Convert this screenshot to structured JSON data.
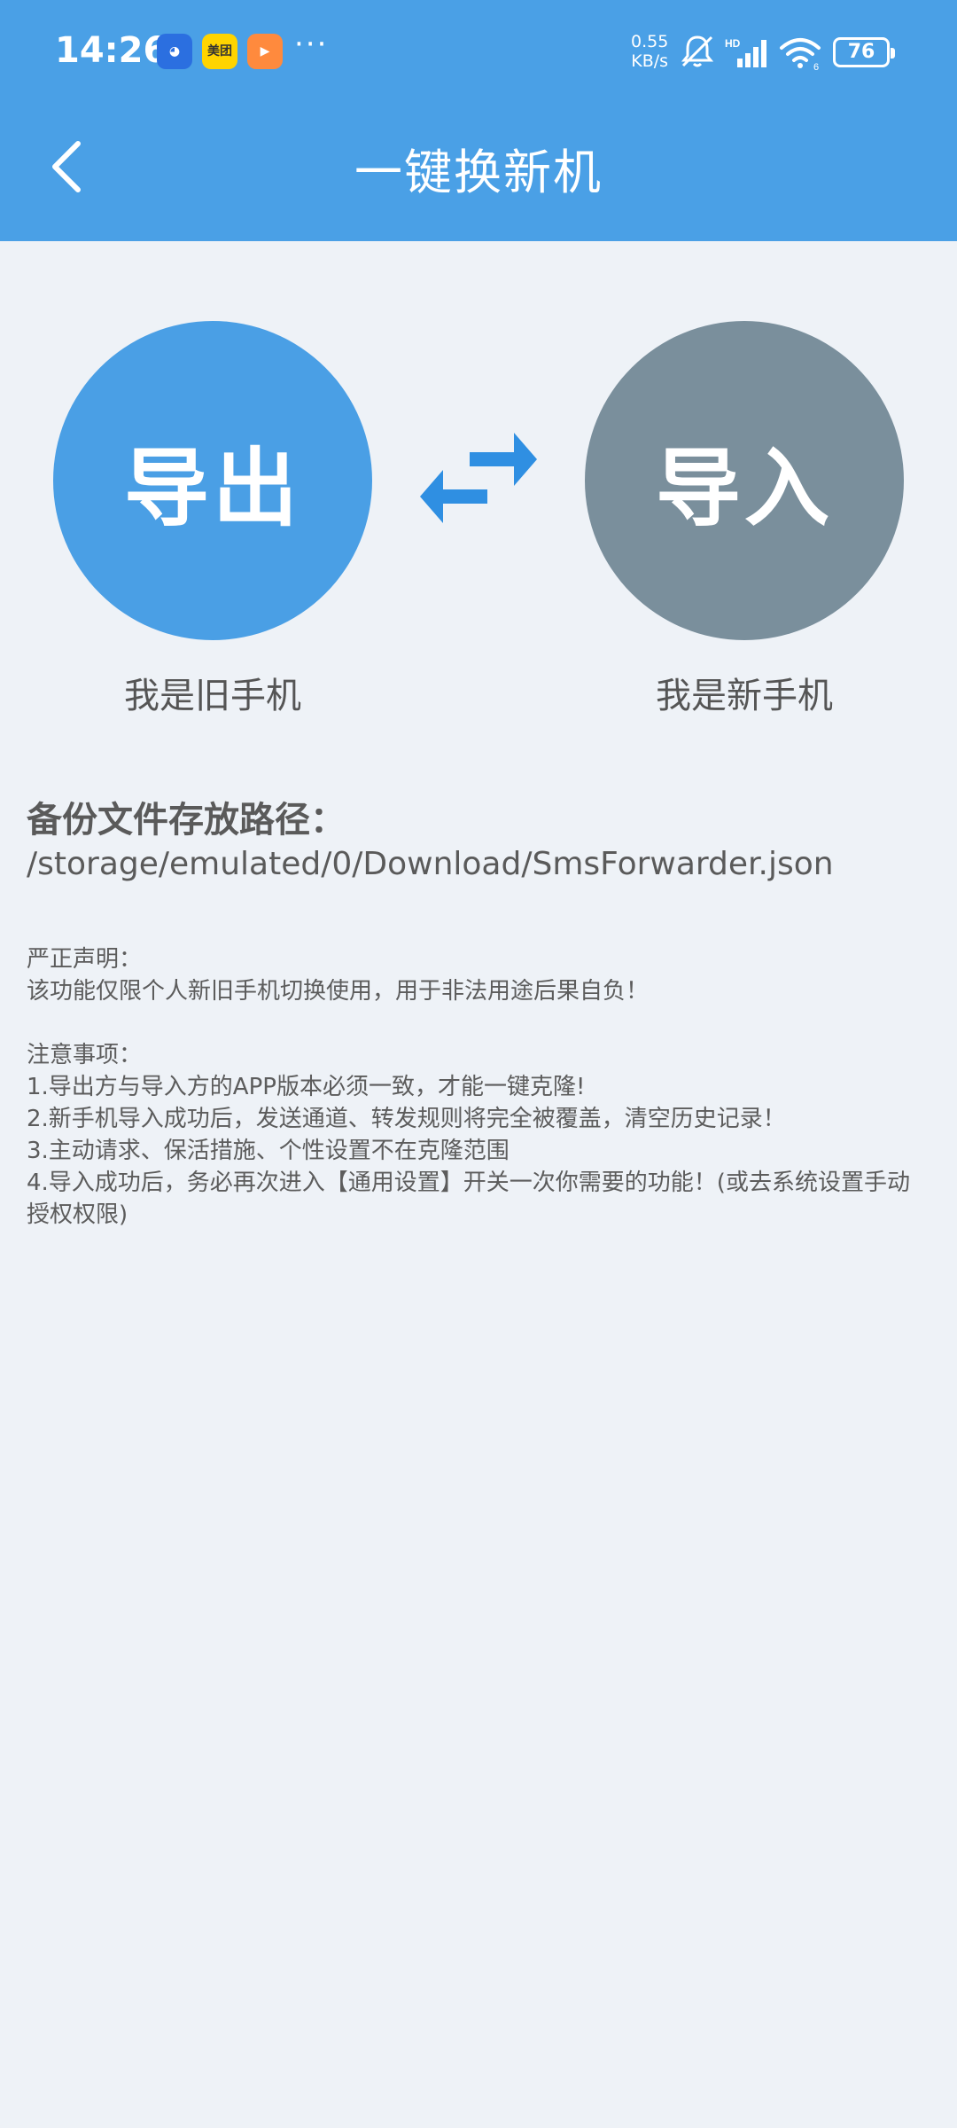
{
  "status_bar": {
    "time": "14:26",
    "app_icons": [
      "qq-icon",
      "meituan-icon",
      "video-icon"
    ],
    "meituan_label": "美团",
    "more": "···",
    "net_speed_value": "0.55",
    "net_speed_unit": "KB/s",
    "signal_label": "HD",
    "wifi_label": "6",
    "battery": "76"
  },
  "header": {
    "title": "一键换新机",
    "back_icon": "back-arrow-icon"
  },
  "actions": {
    "export_label": "导出",
    "import_label": "导入",
    "export_caption": "我是旧手机",
    "import_caption": "我是新手机",
    "swap_icon": "swap-arrows-icon"
  },
  "backup": {
    "label": "备份文件存放路径：",
    "path": "/storage/emulated/0/Download/SmsForwarder.json"
  },
  "notes": {
    "disclaimer_title": "严正声明：",
    "disclaimer_text": "该功能仅限个人新旧手机切换使用，用于非法用途后果自负！",
    "notice_title": "注意事项：",
    "items": [
      "1.导出方与导入方的APP版本必须一致，才能一键克隆!",
      "2.新手机导入成功后，发送通道、转发规则将完全被覆盖，清空历史记录！",
      "3.主动请求、保活措施、个性设置不在克隆范围",
      "4.导入成功后，务必再次进入【通用设置】开关一次你需要的功能！(或去系统设置手动授权权限)"
    ]
  },
  "colors": {
    "header": "#4aa0e6",
    "export_circle": "#4a9fe5",
    "import_circle": "#7a8f9c",
    "background": "#eef2f7"
  }
}
